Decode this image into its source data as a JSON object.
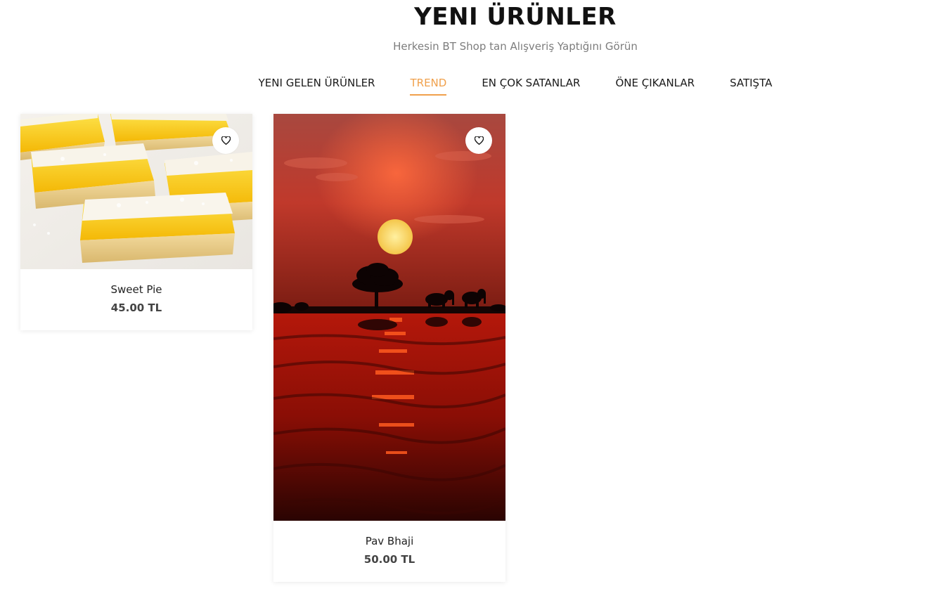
{
  "section": {
    "title": "YENI ÜRÜNLER",
    "subtitle": "Herkesin BT Shop tan Alışveriş Yaptığını Görün"
  },
  "tabs": [
    {
      "label": "YENI GELEN ÜRÜNLER",
      "active": false
    },
    {
      "label": "TREND",
      "active": true
    },
    {
      "label": "EN ÇOK SATANLAR",
      "active": false
    },
    {
      "label": "ÖNE ÇIKANLAR",
      "active": false
    },
    {
      "label": "SATIŞTA",
      "active": false
    }
  ],
  "products": [
    {
      "name": "Sweet Pie",
      "price": "45.00 TL",
      "wishlist_icon": "heart-outline-icon"
    },
    {
      "name": "Pav Bhaji",
      "price": "50.00 TL",
      "wishlist_icon": "heart-outline-icon"
    }
  ],
  "colors": {
    "accent": "#f0a04b",
    "text": "#111111",
    "muted": "#7d7d7d"
  }
}
